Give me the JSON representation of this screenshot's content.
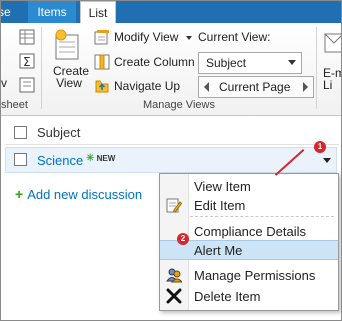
{
  "tabs": {
    "partial": "se",
    "items": "Items",
    "list": "List"
  },
  "ribbon": {
    "partial_left_view": "v",
    "partial_sheet": "sheet",
    "create_view": [
      "Create",
      "View"
    ],
    "modify_view": "Modify View",
    "create_column": "Create Column",
    "navigate_up": "Navigate Up",
    "current_view_label": "Current View:",
    "current_view_value": "Subject",
    "current_page": "Current Page",
    "group_manage_views": "Manage Views",
    "partial_email": [
      "E-m",
      "Li"
    ]
  },
  "list": {
    "column_header": "Subject",
    "row_title": "Science",
    "new_badge": "NEW",
    "add_link": "Add new discussion"
  },
  "menu": {
    "items": [
      "View Item",
      "Edit Item",
      "Compliance Details",
      "Alert Me",
      "Manage Permissions",
      "Delete Item"
    ],
    "highlighted": "Alert Me"
  },
  "callouts": [
    "1",
    "2"
  ],
  "colors": {
    "accent": "#1f6fb2",
    "link": "#0072c6",
    "callout": "#d8262e",
    "highlight": "#cde4f6"
  }
}
